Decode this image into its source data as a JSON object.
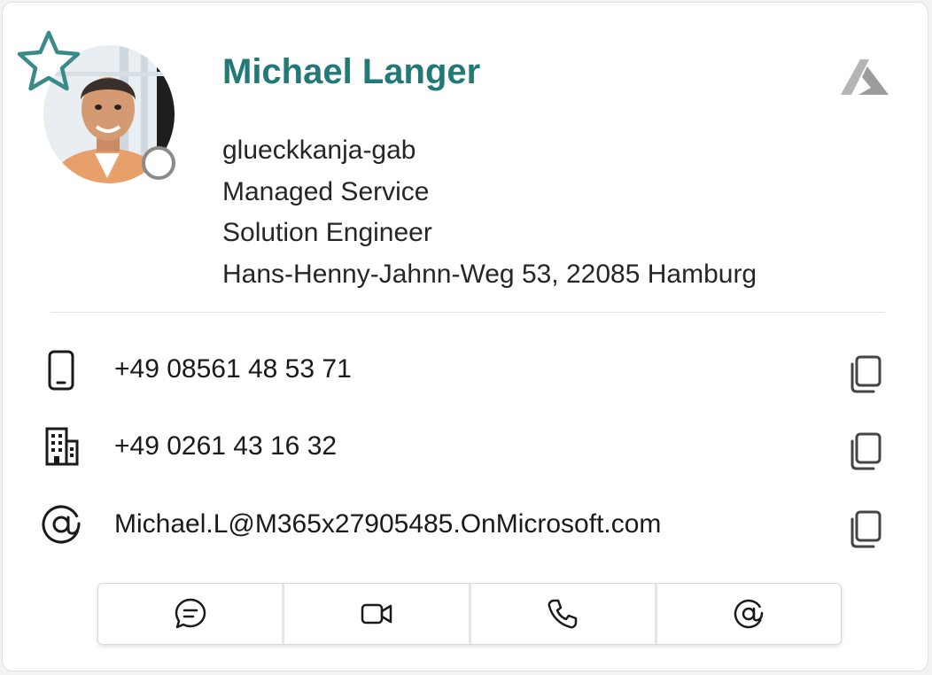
{
  "contact": {
    "name": "Michael Langer",
    "company": "glueckkanja-gab",
    "department": "Managed Service",
    "title": "Solution Engineer",
    "address": "Hans-Henny-Jahnn-Weg 53, 22085 Hamburg",
    "favorite": false,
    "presence": "offline"
  },
  "details": {
    "mobile": "+49 08561 48 53 71",
    "work_phone": "+49 0261 43 16 32",
    "email": "Michael.L@M365x27905485.OnMicrosoft.com"
  },
  "icons": {
    "favorite": "star-icon",
    "source": "azure-logo-icon",
    "mobile": "mobile-phone-icon",
    "work_phone": "building-icon",
    "email": "at-sign-icon",
    "copy": "copy-icon",
    "actions": [
      "chat-icon",
      "video-call-icon",
      "phone-call-icon",
      "email-icon"
    ]
  },
  "colors": {
    "name": "#237878",
    "star": "#3a8a8a",
    "presence_ring": "#8a8a8a",
    "text": "#262626"
  }
}
